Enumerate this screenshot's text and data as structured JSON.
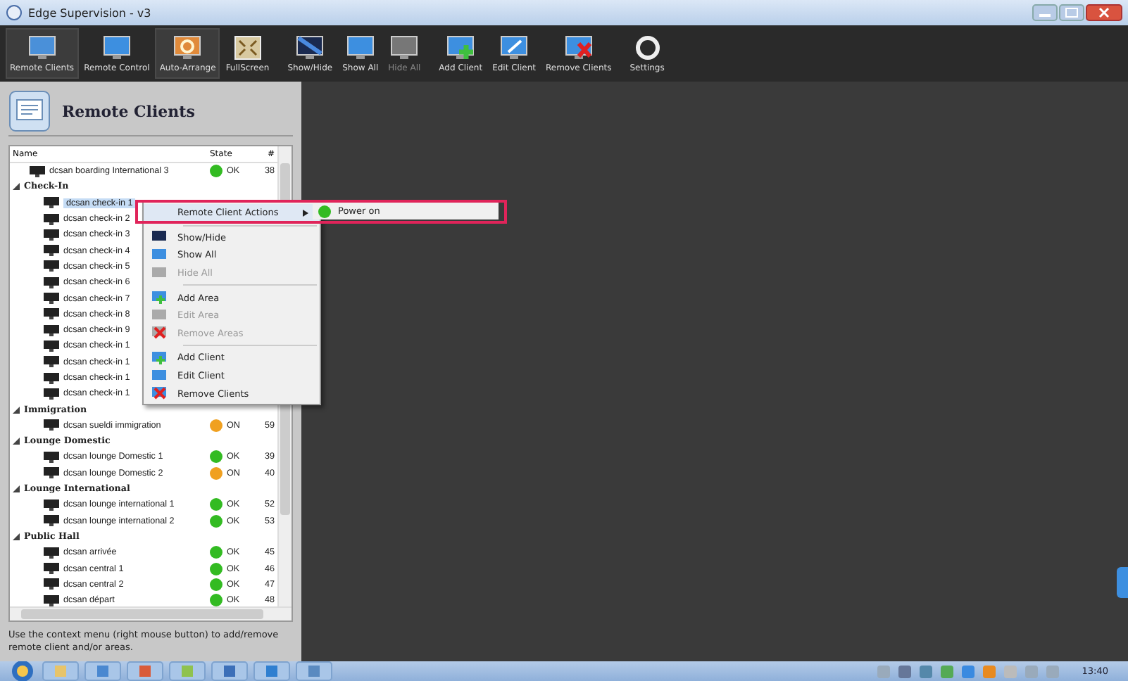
{
  "window": {
    "title": "Edge Supervision - v3"
  },
  "toolbar": [
    {
      "label": "Remote Clients",
      "kind": "search",
      "active": true,
      "disabled": false
    },
    {
      "label": "Remote Control",
      "kind": "monitor",
      "active": false,
      "disabled": false
    },
    {
      "label": "Auto-Arrange",
      "kind": "arrange",
      "active": true,
      "disabled": false
    },
    {
      "label": "FullScreen",
      "kind": "fullscreen",
      "active": false,
      "disabled": false
    },
    {
      "label": "Show/Hide",
      "kind": "dark",
      "active": false,
      "disabled": false
    },
    {
      "label": "Show All",
      "kind": "monitor",
      "active": false,
      "disabled": false
    },
    {
      "label": "Hide All",
      "kind": "grey",
      "active": false,
      "disabled": true
    },
    {
      "label": "Add Client",
      "kind": "add",
      "active": false,
      "disabled": false
    },
    {
      "label": "Edit Client",
      "kind": "edit",
      "active": false,
      "disabled": false
    },
    {
      "label": "Remove Clients",
      "kind": "remove",
      "active": false,
      "disabled": false
    },
    {
      "label": "Settings",
      "kind": "settings",
      "active": false,
      "disabled": false
    }
  ],
  "panel": {
    "title": "Remote Clients",
    "columns": [
      "Name",
      "State",
      "#"
    ],
    "tree": [
      {
        "kind": "client",
        "name": "dcsan boarding International 3",
        "state": "OK",
        "color": "#33bb22",
        "number": "38",
        "selected": false
      },
      {
        "kind": "group",
        "name": "Check-In",
        "expanded": true,
        "children": [
          {
            "kind": "client",
            "name": "dcsan check-in 1",
            "selected": true
          },
          {
            "kind": "client",
            "name": "dcsan check-in 2",
            "selected": false
          },
          {
            "kind": "client",
            "name": "dcsan check-in 3",
            "selected": false
          },
          {
            "kind": "client",
            "name": "dcsan check-in 4",
            "selected": false
          },
          {
            "kind": "client",
            "name": "dcsan check-in 5",
            "selected": false
          },
          {
            "kind": "client",
            "name": "dcsan check-in 6",
            "selected": false
          },
          {
            "kind": "client",
            "name": "dcsan check-in 7",
            "selected": false
          },
          {
            "kind": "client",
            "name": "dcsan check-in 8",
            "selected": false
          },
          {
            "kind": "client",
            "name": "dcsan check-in 9",
            "selected": false
          },
          {
            "kind": "client",
            "name": "dcsan check-in 1",
            "selected": false
          },
          {
            "kind": "client",
            "name": "dcsan check-in 1",
            "selected": false
          },
          {
            "kind": "client",
            "name": "dcsan check-in 1",
            "selected": false
          },
          {
            "kind": "client",
            "name": "dcsan check-in 1",
            "selected": false
          }
        ]
      },
      {
        "kind": "group",
        "name": "Immigration",
        "expanded": true,
        "children": [
          {
            "kind": "client",
            "name": "dcsan sueldi immigration",
            "state": "ON",
            "color": "#f0a020",
            "number": "59",
            "selected": false
          }
        ]
      },
      {
        "kind": "group",
        "name": "Lounge Domestic",
        "expanded": true,
        "children": [
          {
            "kind": "client",
            "name": "dcsan lounge Domestic 1",
            "state": "OK",
            "color": "#33bb22",
            "number": "39",
            "selected": false
          },
          {
            "kind": "client",
            "name": "dcsan lounge Domestic 2",
            "state": "ON",
            "color": "#f0a020",
            "number": "40",
            "selected": false
          }
        ]
      },
      {
        "kind": "group",
        "name": "Lounge International",
        "expanded": true,
        "children": [
          {
            "kind": "client",
            "name": "dcsan lounge international 1",
            "state": "OK",
            "color": "#33bb22",
            "number": "52",
            "selected": false
          },
          {
            "kind": "client",
            "name": "dcsan lounge international 2",
            "state": "OK",
            "color": "#33bb22",
            "number": "53",
            "selected": false
          }
        ]
      },
      {
        "kind": "group",
        "name": "Public Hall",
        "expanded": true,
        "children": [
          {
            "kind": "client",
            "name": "dcsan arrivée",
            "state": "OK",
            "color": "#33bb22",
            "number": "45",
            "selected": false
          },
          {
            "kind": "client",
            "name": "dcsan central 1",
            "state": "OK",
            "color": "#33bb22",
            "number": "46",
            "selected": false
          },
          {
            "kind": "client",
            "name": "dcsan central 2",
            "state": "OK",
            "color": "#33bb22",
            "number": "47",
            "selected": false
          },
          {
            "kind": "client",
            "name": "dcsan départ",
            "state": "OK",
            "color": "#33bb22",
            "number": "48",
            "selected": false
          }
        ]
      }
    ],
    "hint": "Use the context menu (right mouse button) to add/remove remote client and/or areas."
  },
  "context_menu": [
    {
      "kind": "submenu",
      "label": "Remote Client Actions",
      "selected": true,
      "disabled": false
    },
    {
      "kind": "separator"
    },
    {
      "kind": "dark",
      "label": "Show/Hide",
      "selected": false,
      "disabled": false
    },
    {
      "kind": "monitor",
      "label": "Show All",
      "selected": false,
      "disabled": false
    },
    {
      "kind": "grey",
      "label": "Hide All",
      "selected": false,
      "disabled": true
    },
    {
      "kind": "separator"
    },
    {
      "kind": "add",
      "label": "Add Area",
      "selected": false,
      "disabled": false
    },
    {
      "kind": "edit",
      "label": "Edit Area",
      "selected": false,
      "disabled": true
    },
    {
      "kind": "remove",
      "label": "Remove Areas",
      "selected": false,
      "disabled": true
    },
    {
      "kind": "separator"
    },
    {
      "kind": "add",
      "label": "Add Client",
      "selected": false,
      "disabled": false
    },
    {
      "kind": "edit",
      "label": "Edit Client",
      "selected": false,
      "disabled": false
    },
    {
      "kind": "remove",
      "label": "Remove Clients",
      "selected": false,
      "disabled": false
    }
  ],
  "submenu": [
    {
      "label": "Power on",
      "color": "#33bb22"
    }
  ],
  "taskbar": {
    "clock": "13:40"
  }
}
